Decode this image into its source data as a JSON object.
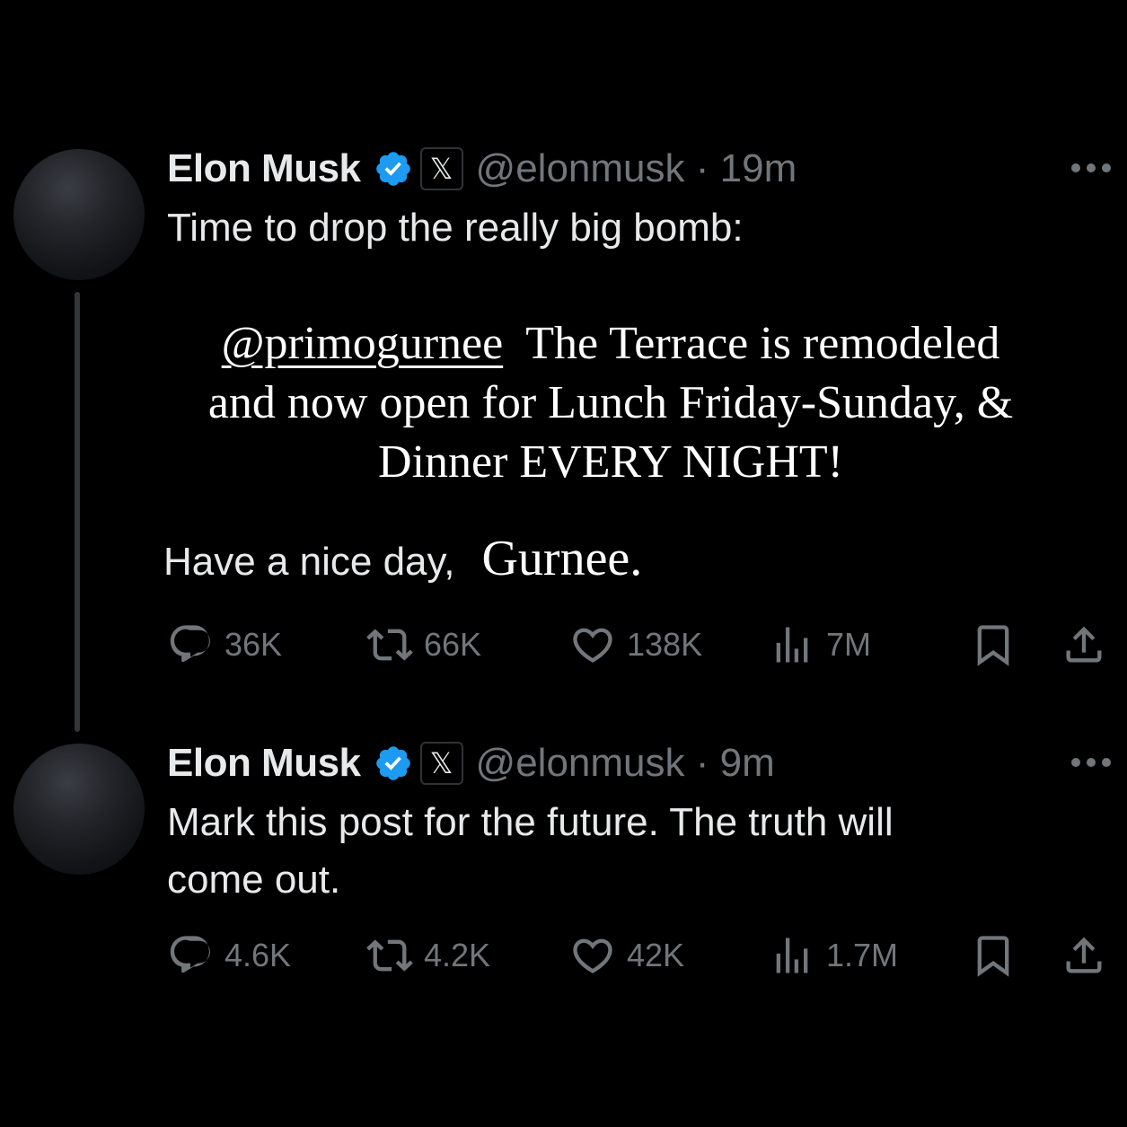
{
  "colors": {
    "background": "#000000",
    "text": "#e7e9ea",
    "secondary": "#71767b",
    "verified": "#1d9bf0"
  },
  "posts": [
    {
      "author": {
        "name": "Elon Musk",
        "handle": "@elonmusk",
        "time": "19m",
        "affiliate_badge": "𝕏"
      },
      "text": "Time to drop the really big bomb:",
      "embedded": {
        "mention": "@primogurnee",
        "line1_rest": "The Terrace is remodeled",
        "line2": "and now open for Lunch Friday-Sunday, &",
        "line3": "Dinner EVERY NIGHT!"
      },
      "closing": {
        "part1": "Have a nice day,",
        "part2": "Gurnee."
      },
      "stats": {
        "replies": "36K",
        "reposts": "66K",
        "likes": "138K",
        "views": "7M"
      }
    },
    {
      "author": {
        "name": "Elon Musk",
        "handle": "@elonmusk",
        "time": "9m",
        "affiliate_badge": "𝕏"
      },
      "text_line1": "Mark this post for the future. The truth will",
      "text_line2": "come out.",
      "stats": {
        "replies": "4.6K",
        "reposts": "4.2K",
        "likes": "42K",
        "views": "1.7M"
      }
    }
  ]
}
